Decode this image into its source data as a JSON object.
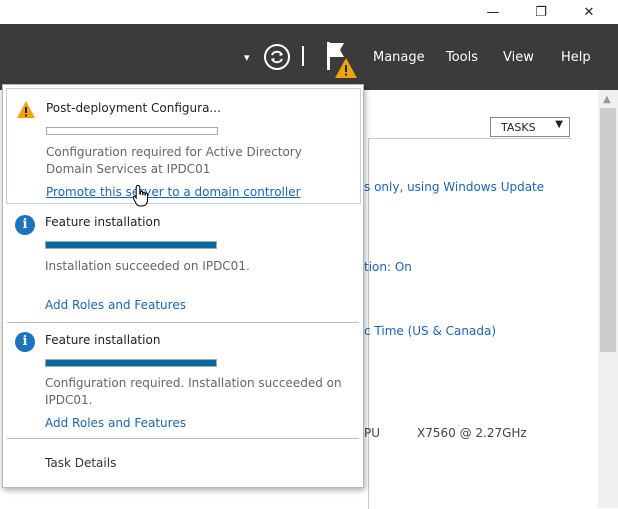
{
  "window_controls": {
    "minimize": "—",
    "restore": "❐",
    "close": "✕"
  },
  "toolbar": {
    "menu": [
      "Manage",
      "Tools",
      "View",
      "Help"
    ],
    "dropdown_arrow": "▾",
    "refresh_icon": "refresh-icon",
    "flag_icon": "flag-warning-icon"
  },
  "background": {
    "tasks_label": "TASKS",
    "tasks_arrow": "▼",
    "lines": [
      "s only, using Windows Update",
      "tion: On",
      "c Time (US & Canada)",
      "PU",
      "X7560  @ 2.27GHz"
    ]
  },
  "notifications": {
    "items": [
      {
        "icon": "warning-icon",
        "title": "Post-deployment Configura...",
        "progress": 0,
        "description": "Configuration required for Active Directory Domain Services at IPDC01",
        "link": "Promote this server to a domain controller"
      },
      {
        "icon": "info-icon",
        "title": "Feature installation",
        "progress": 1,
        "description": "Installation succeeded on IPDC01.",
        "link": "Add Roles and Features"
      },
      {
        "icon": "info-icon",
        "title": "Feature installation",
        "progress": 1,
        "description": "Configuration required. Installation succeeded on IPDC01.",
        "link": "Add Roles and Features"
      }
    ],
    "task_details": "Task Details"
  },
  "colors": {
    "accent": "#006b9f",
    "link": "#1b66b5",
    "toolbar_bg": "#3b3b3b",
    "warning": "#f0a30a"
  }
}
